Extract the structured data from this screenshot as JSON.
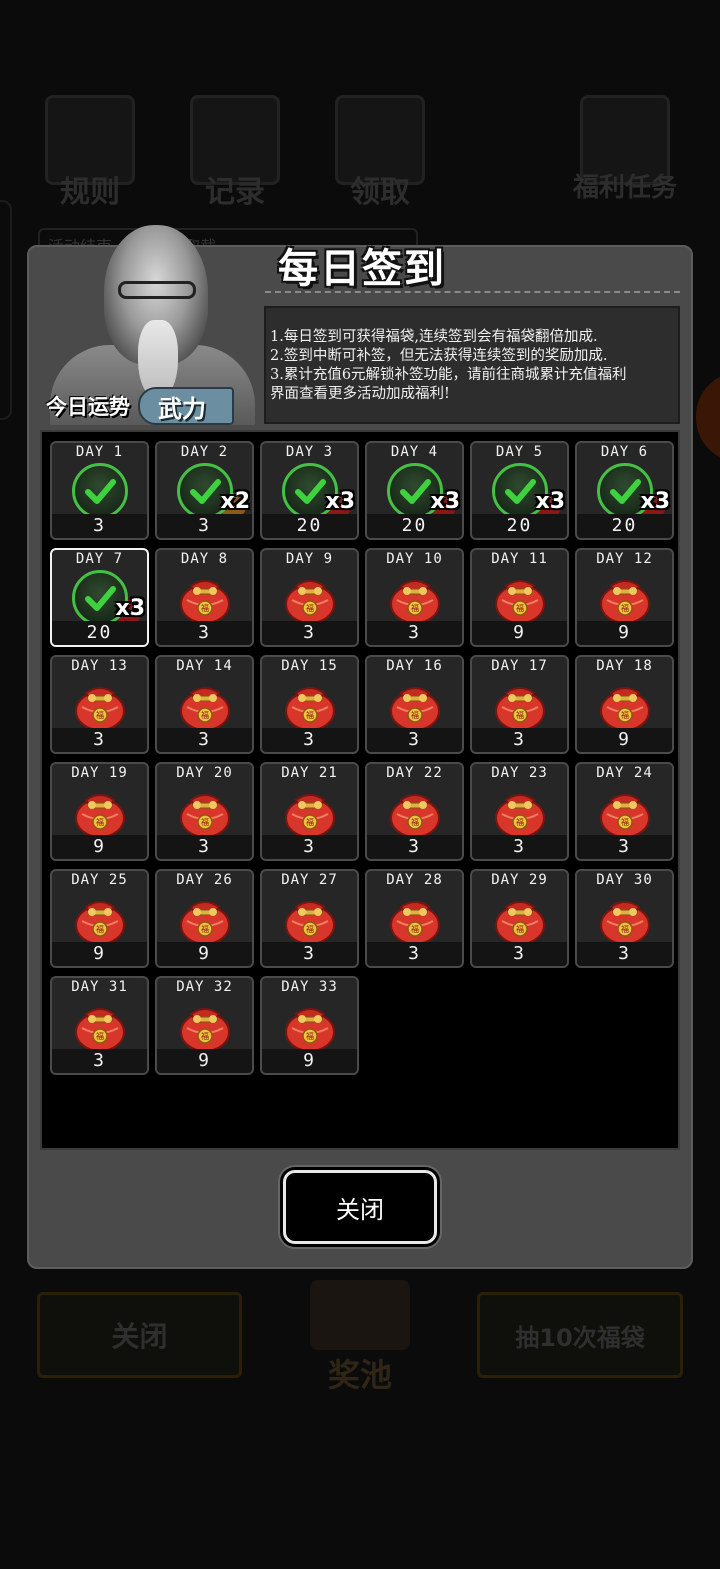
{
  "background": {
    "top_icons": [
      "规则",
      "记录",
      "领取",
      "福利任务"
    ],
    "info_bar": "活动结束 ... /01 领取截",
    "bottom_left_button": "关闭",
    "bottom_center": "奖池",
    "bottom_right_button": "抽10次福袋"
  },
  "dialog": {
    "title": "每日签到",
    "fortune_label": "今日运势",
    "fortune_value": "武力",
    "rules": [
      "1.每日签到可获得福袋,连续签到会有福袋翻倍加成.",
      "2.签到中断可补签，但无法获得连续签到的奖励加成.",
      "3.累计充值6元解锁补签功能，请前往商城累计充值福利",
      "界面查看更多活动加成福利!"
    ],
    "close_button": "关闭",
    "days": [
      {
        "day": "DAY 1",
        "value": "3",
        "claimed": true,
        "mult": ""
      },
      {
        "day": "DAY 2",
        "value": "3",
        "claimed": true,
        "mult": "x2"
      },
      {
        "day": "DAY 3",
        "value": "20",
        "claimed": true,
        "mult": "x3"
      },
      {
        "day": "DAY 4",
        "value": "20",
        "claimed": true,
        "mult": "x3"
      },
      {
        "day": "DAY 5",
        "value": "20",
        "claimed": true,
        "mult": "x3"
      },
      {
        "day": "DAY 6",
        "value": "20",
        "claimed": true,
        "mult": "x3"
      },
      {
        "day": "DAY 7",
        "value": "20",
        "claimed": true,
        "mult": "x3",
        "today": true
      },
      {
        "day": "DAY 8",
        "value": "3"
      },
      {
        "day": "DAY 9",
        "value": "3"
      },
      {
        "day": "DAY 10",
        "value": "3"
      },
      {
        "day": "DAY 11",
        "value": "9"
      },
      {
        "day": "DAY 12",
        "value": "9"
      },
      {
        "day": "DAY 13",
        "value": "3"
      },
      {
        "day": "DAY 14",
        "value": "3"
      },
      {
        "day": "DAY 15",
        "value": "3"
      },
      {
        "day": "DAY 16",
        "value": "3"
      },
      {
        "day": "DAY 17",
        "value": "3"
      },
      {
        "day": "DAY 18",
        "value": "9"
      },
      {
        "day": "DAY 19",
        "value": "9"
      },
      {
        "day": "DAY 20",
        "value": "3"
      },
      {
        "day": "DAY 21",
        "value": "3"
      },
      {
        "day": "DAY 22",
        "value": "3"
      },
      {
        "day": "DAY 23",
        "value": "3"
      },
      {
        "day": "DAY 24",
        "value": "3"
      },
      {
        "day": "DAY 25",
        "value": "9"
      },
      {
        "day": "DAY 26",
        "value": "9"
      },
      {
        "day": "DAY 27",
        "value": "3"
      },
      {
        "day": "DAY 28",
        "value": "3"
      },
      {
        "day": "DAY 29",
        "value": "3"
      },
      {
        "day": "DAY 30",
        "value": "3"
      },
      {
        "day": "DAY 31",
        "value": "3"
      },
      {
        "day": "DAY 32",
        "value": "9"
      },
      {
        "day": "DAY 33",
        "value": "9"
      }
    ]
  },
  "colors": {
    "check_green": "#45c045",
    "bag_red": "#d8362a",
    "panel_gray": "#4a4a4a"
  }
}
